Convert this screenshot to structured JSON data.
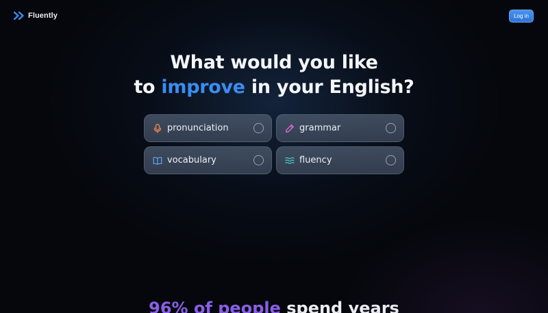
{
  "brand": {
    "name": "Fluently",
    "logo_icon": "double-chevron-right-icon",
    "logo_color": "#3b8cf0"
  },
  "header": {
    "login_label": "Log in"
  },
  "hero": {
    "line1": "What would you like",
    "line2_pre": "to ",
    "line2_accent": "improve",
    "line2_post": " in your English?",
    "accent_color": "#3b8cf0"
  },
  "options": [
    {
      "label": "pronunciation",
      "icon": "microphone-icon",
      "icon_color": "#e8845a",
      "selected": false
    },
    {
      "label": "grammar",
      "icon": "pencil-icon",
      "icon_color": "#d96ad8",
      "selected": false
    },
    {
      "label": "vocabulary",
      "icon": "book-icon",
      "icon_color": "#5b9ee8",
      "selected": false
    },
    {
      "label": "fluency",
      "icon": "waves-icon",
      "icon_color": "#4cc8c8",
      "selected": false
    }
  ],
  "teaser": {
    "accent": "96% of people",
    "rest": " spend years",
    "accent_color": "#8a5ee8"
  }
}
